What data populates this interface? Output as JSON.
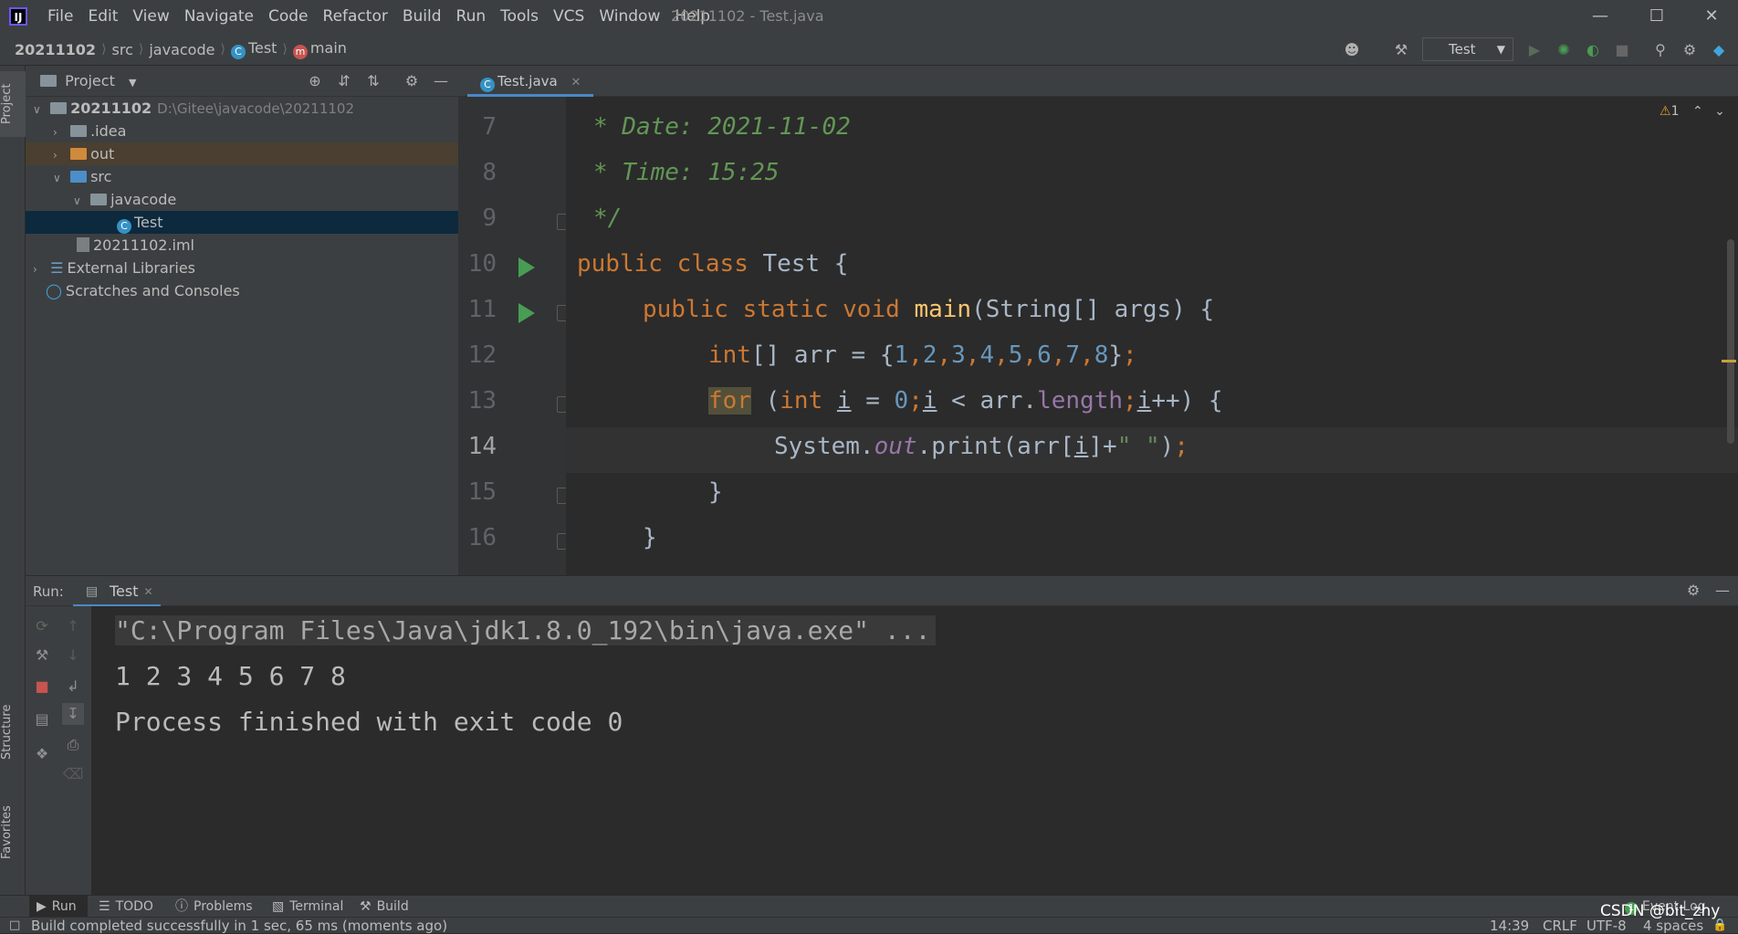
{
  "app": {
    "window_title": "20211102 - Test.java",
    "menus": [
      "File",
      "Edit",
      "View",
      "Navigate",
      "Code",
      "Refactor",
      "Build",
      "Run",
      "Tools",
      "VCS",
      "Window",
      "Help"
    ]
  },
  "breadcrumb": {
    "project": "20211102",
    "src": "src",
    "package": "javacode",
    "class": "Test",
    "method": "main"
  },
  "toolbar": {
    "run_config": "Test"
  },
  "project_panel": {
    "title": "Project",
    "root_name": "20211102",
    "root_path": "D:\\Gitee\\javacode\\20211102",
    "items": [
      {
        "label": ".idea"
      },
      {
        "label": "out"
      },
      {
        "label": "src"
      },
      {
        "label": "javacode"
      },
      {
        "label": "Test"
      },
      {
        "label": "20211102.iml"
      },
      {
        "label": "External Libraries"
      },
      {
        "label": "Scratches and Consoles"
      }
    ]
  },
  "editor": {
    "tab_label": "Test.java",
    "warning_count": "1",
    "line_numbers": [
      "7",
      "8",
      "9",
      "10",
      "11",
      "12",
      "13",
      "14",
      "15",
      "16"
    ],
    "lines": {
      "l7": {
        "a": "* Date: 2021-11-02"
      },
      "l8": {
        "a": "* Time: 15:25"
      },
      "l9": {
        "a": "*/"
      },
      "l10": {
        "kw1": "public",
        "kw2": "class",
        "name": "Test",
        "brace": "{"
      },
      "l11": {
        "kw1": "public",
        "kw2": "static",
        "kw3": "void",
        "fn": "main",
        "rest": "(String[] args) {"
      },
      "l12": {
        "kw1": "int",
        "a": "[] arr = {",
        "n1": "1",
        "n2": "2",
        "n3": "3",
        "n4": "4",
        "n5": "5",
        "n6": "6",
        "n7": "7",
        "n8": "8",
        "comma": ",",
        "end": "}",
        "semi": ";"
      },
      "l13": {
        "kw_for": "for",
        "p1": " (",
        "kw_int": "int",
        "sp": " ",
        "i": "i",
        "eq": " = ",
        "zero": "0",
        "semi": ";",
        "lt": " < arr.",
        "field": "length",
        "inc": "++) {"
      },
      "l14": {
        "a": "System.",
        "out": "out",
        "b": ".print(arr[",
        "i": "i",
        "c": "]+",
        "str": "\" \"",
        "d": ")",
        "semi": ";"
      },
      "l15": {
        "a": "}"
      },
      "l16": {
        "a": "}"
      }
    }
  },
  "run_panel": {
    "label": "Run:",
    "tab": "Test",
    "console": {
      "command": "\"C:\\Program Files\\Java\\jdk1.8.0_192\\bin\\java.exe\" ...",
      "output": "1 2 3 4 5 6 7 8",
      "exit": "Process finished with exit code 0"
    }
  },
  "tool_windows": {
    "left_top": "Project",
    "left_structure": "Structure",
    "left_favorites": "Favorites",
    "bottom": [
      "Run",
      "TODO",
      "Problems",
      "Terminal",
      "Build"
    ],
    "event_log": "Event Log"
  },
  "status_bar": {
    "message": "Build completed successfully in 1 sec, 65 ms (moments ago)",
    "position": "14:39",
    "line_sep": "CRLF",
    "encoding": "UTF-8",
    "indent": "4 spaces"
  },
  "watermark": "CSDN @bit_zhy",
  "colors": {
    "keyword": "#cc7832",
    "comment": "#629755",
    "number": "#6897bb",
    "string": "#6a8759",
    "function": "#ffc66d",
    "field": "#9876aa",
    "accent": "#4a88c7",
    "run_green": "#499c54"
  }
}
